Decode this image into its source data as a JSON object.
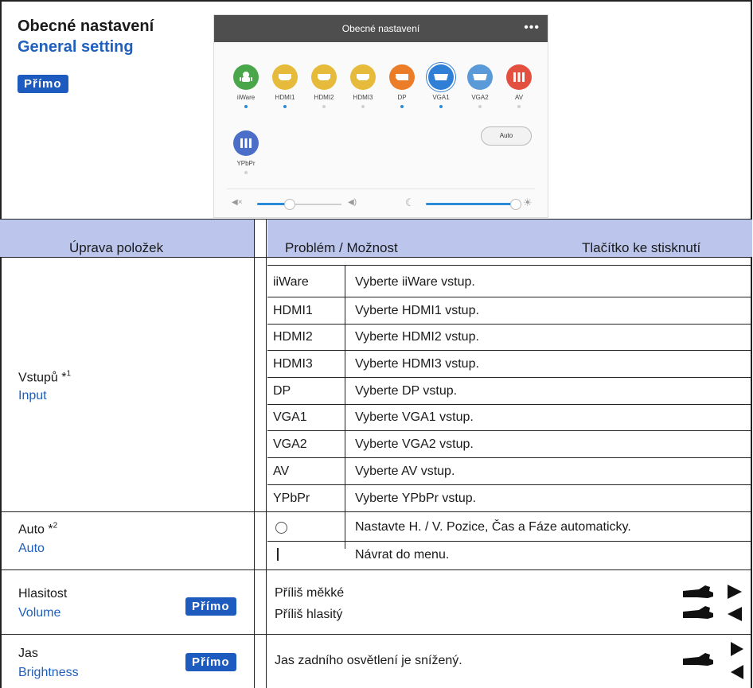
{
  "header": {
    "title_cz": "Obecné nastavení",
    "title_en": "General setting",
    "badge": "Přímo"
  },
  "screenshot": {
    "title": "Obecné nastavení",
    "menu_glyph": "•••",
    "sources": [
      {
        "label": "iiWare",
        "color": "#4aa64a",
        "dot": "#2a8bd8"
      },
      {
        "label": "HDMI1",
        "color": "#e6ba3a",
        "dot": "#2a8bd8"
      },
      {
        "label": "HDMI2",
        "color": "#e6ba3a",
        "dot": "#d0d0d0"
      },
      {
        "label": "HDMI3",
        "color": "#e6ba3a",
        "dot": "#d0d0d0"
      },
      {
        "label": "DP",
        "color": "#ec7d28",
        "dot": "#2a8bd8"
      },
      {
        "label": "VGA1",
        "color": "#2f7fd6",
        "dot": "#2a8bd8"
      },
      {
        "label": "VGA2",
        "color": "#5b9ad8",
        "dot": "#d0d0d0"
      },
      {
        "label": "AV",
        "color": "#e4503f",
        "dot": "#d0d0d0"
      }
    ],
    "source_extra": {
      "label": "YPbPr",
      "color": "#4b6fc9"
    },
    "auto_label": "Auto"
  },
  "table": {
    "headers": {
      "item": "Úprava položek",
      "problem": "Problém / Možnost",
      "button": "Tlačítko ke stisknutí"
    },
    "input": {
      "label_cz": "Vstupů",
      "note": "*1",
      "label_en": "Input",
      "rows": [
        {
          "key": "iiWare",
          "desc": "Vyberte iiWare vstup."
        },
        {
          "key": "HDMI1",
          "desc": "Vyberte HDMI1 vstup."
        },
        {
          "key": "HDMI2",
          "desc": "Vyberte HDMI2 vstup."
        },
        {
          "key": "HDMI3",
          "desc": "Vyberte HDMI3 vstup."
        },
        {
          "key": "DP",
          "desc": "Vyberte DP vstup."
        },
        {
          "key": "VGA1",
          "desc": "Vyberte VGA1 vstup."
        },
        {
          "key": "VGA2",
          "desc": "Vyberte VGA2 vstup."
        },
        {
          "key": "AV",
          "desc": "Vyberte AV vstup."
        },
        {
          "key": "YPbPr",
          "desc": "Vyberte YPbPr vstup."
        }
      ]
    },
    "auto": {
      "label_cz": "Auto",
      "note": "*2",
      "label_en": "Auto",
      "row1": "Nastavte H. / V. Pozice, Čas a Fáze automaticky.",
      "row2": "Návrat do menu."
    },
    "volume": {
      "label_cz": "Hlasitost",
      "label_en": "Volume",
      "badge": "Přímo",
      "row1": "Příliš měkké",
      "row2": "Příliš hlasitý"
    },
    "brightness": {
      "label_cz": "Jas",
      "label_en": "Brightness",
      "badge": "Přímo",
      "row1": "Jas zadního osvětlení je snížený."
    }
  }
}
